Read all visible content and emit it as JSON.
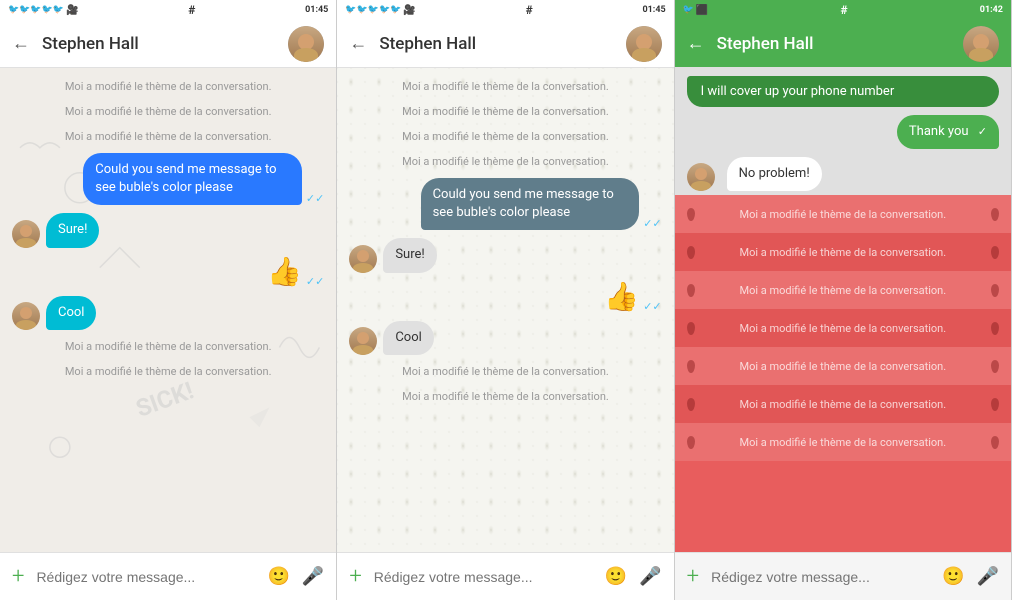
{
  "panels": [
    {
      "id": "panel1",
      "status_bar": {
        "left_icons": "🐦🐦🐦🐦🐦⬛",
        "hash": "#",
        "right_icons": "⊖ ▼ ▲ 📶 01:45"
      },
      "header": {
        "title": "Stephen Hall",
        "back": "←"
      },
      "theme_message": "Moi a modifié le thème de la conversation.",
      "messages": [
        {
          "type": "system",
          "text": "Moi a modifié le thème de la conversation."
        },
        {
          "type": "system",
          "text": "Moi a modifié le thème de la conversation."
        },
        {
          "type": "system",
          "text": "Moi a modifié le thème de la conversation."
        },
        {
          "type": "sent",
          "text": "Could you send me message to see buble's color please",
          "style": "blue"
        },
        {
          "type": "received",
          "text": "Sure!",
          "style": "cyan"
        },
        {
          "type": "sent",
          "text": "👍",
          "emoji": true
        },
        {
          "type": "received",
          "text": "Cool",
          "style": "cyan"
        },
        {
          "type": "system",
          "text": "Moi a modifié le thème de la conversation."
        },
        {
          "type": "system",
          "text": "Moi a modifié le thème de la conversation."
        }
      ],
      "input_placeholder": "Rédigez votre message..."
    },
    {
      "id": "panel2",
      "status_bar": {
        "left_icons": "🐦🐦🐦🐦🐦⬛",
        "hash": "#",
        "right_icons": "⊖ ▼ ▲ 📶 01:45"
      },
      "header": {
        "title": "Stephen Hall",
        "back": "←"
      },
      "messages": [
        {
          "type": "system",
          "text": "Moi a modifié le thème de la conversation."
        },
        {
          "type": "system",
          "text": "Moi a modifié le thème de la conversation."
        },
        {
          "type": "system",
          "text": "Moi a modifié le thème de la conversation."
        },
        {
          "type": "system",
          "text": "Moi a modifié le thème de la conversation."
        },
        {
          "type": "sent",
          "text": "Could you send me message to see buble's color please",
          "style": "gray"
        },
        {
          "type": "received",
          "text": "Sure!",
          "style": "white"
        },
        {
          "type": "sent",
          "text": "👍",
          "emoji": true
        },
        {
          "type": "received",
          "text": "Cool",
          "style": "white"
        },
        {
          "type": "system",
          "text": "Moi a modifié le thème de la conversation."
        },
        {
          "type": "system",
          "text": "Moi a modifié le thème de la conversation."
        }
      ],
      "input_placeholder": "Rédigez votre message..."
    },
    {
      "id": "panel3",
      "status_bar": {
        "left_icons": "🐦⬛",
        "hash": "#",
        "right_icons": "⊖ ▼ 📶 01:42"
      },
      "header": {
        "title": "Stephen Hall",
        "back": "←",
        "theme": "green"
      },
      "cover_message": "I will cover up your phone number",
      "thank_you": "Thank you",
      "no_problem": "No problem!",
      "stripe_messages": [
        "Moi a modifié le thème de la conversation.",
        "Moi a modifié le thème de la conversation.",
        "Moi a modifié le thème de la conversation.",
        "Moi a modifié le thème de la conversation.",
        "Moi a modifié le thème de la conversation.",
        "Moi a modifié le thème de la conversation.",
        "Moi a modifié le thème de la conversation."
      ],
      "input_placeholder": "Rédigez votre message..."
    }
  ]
}
